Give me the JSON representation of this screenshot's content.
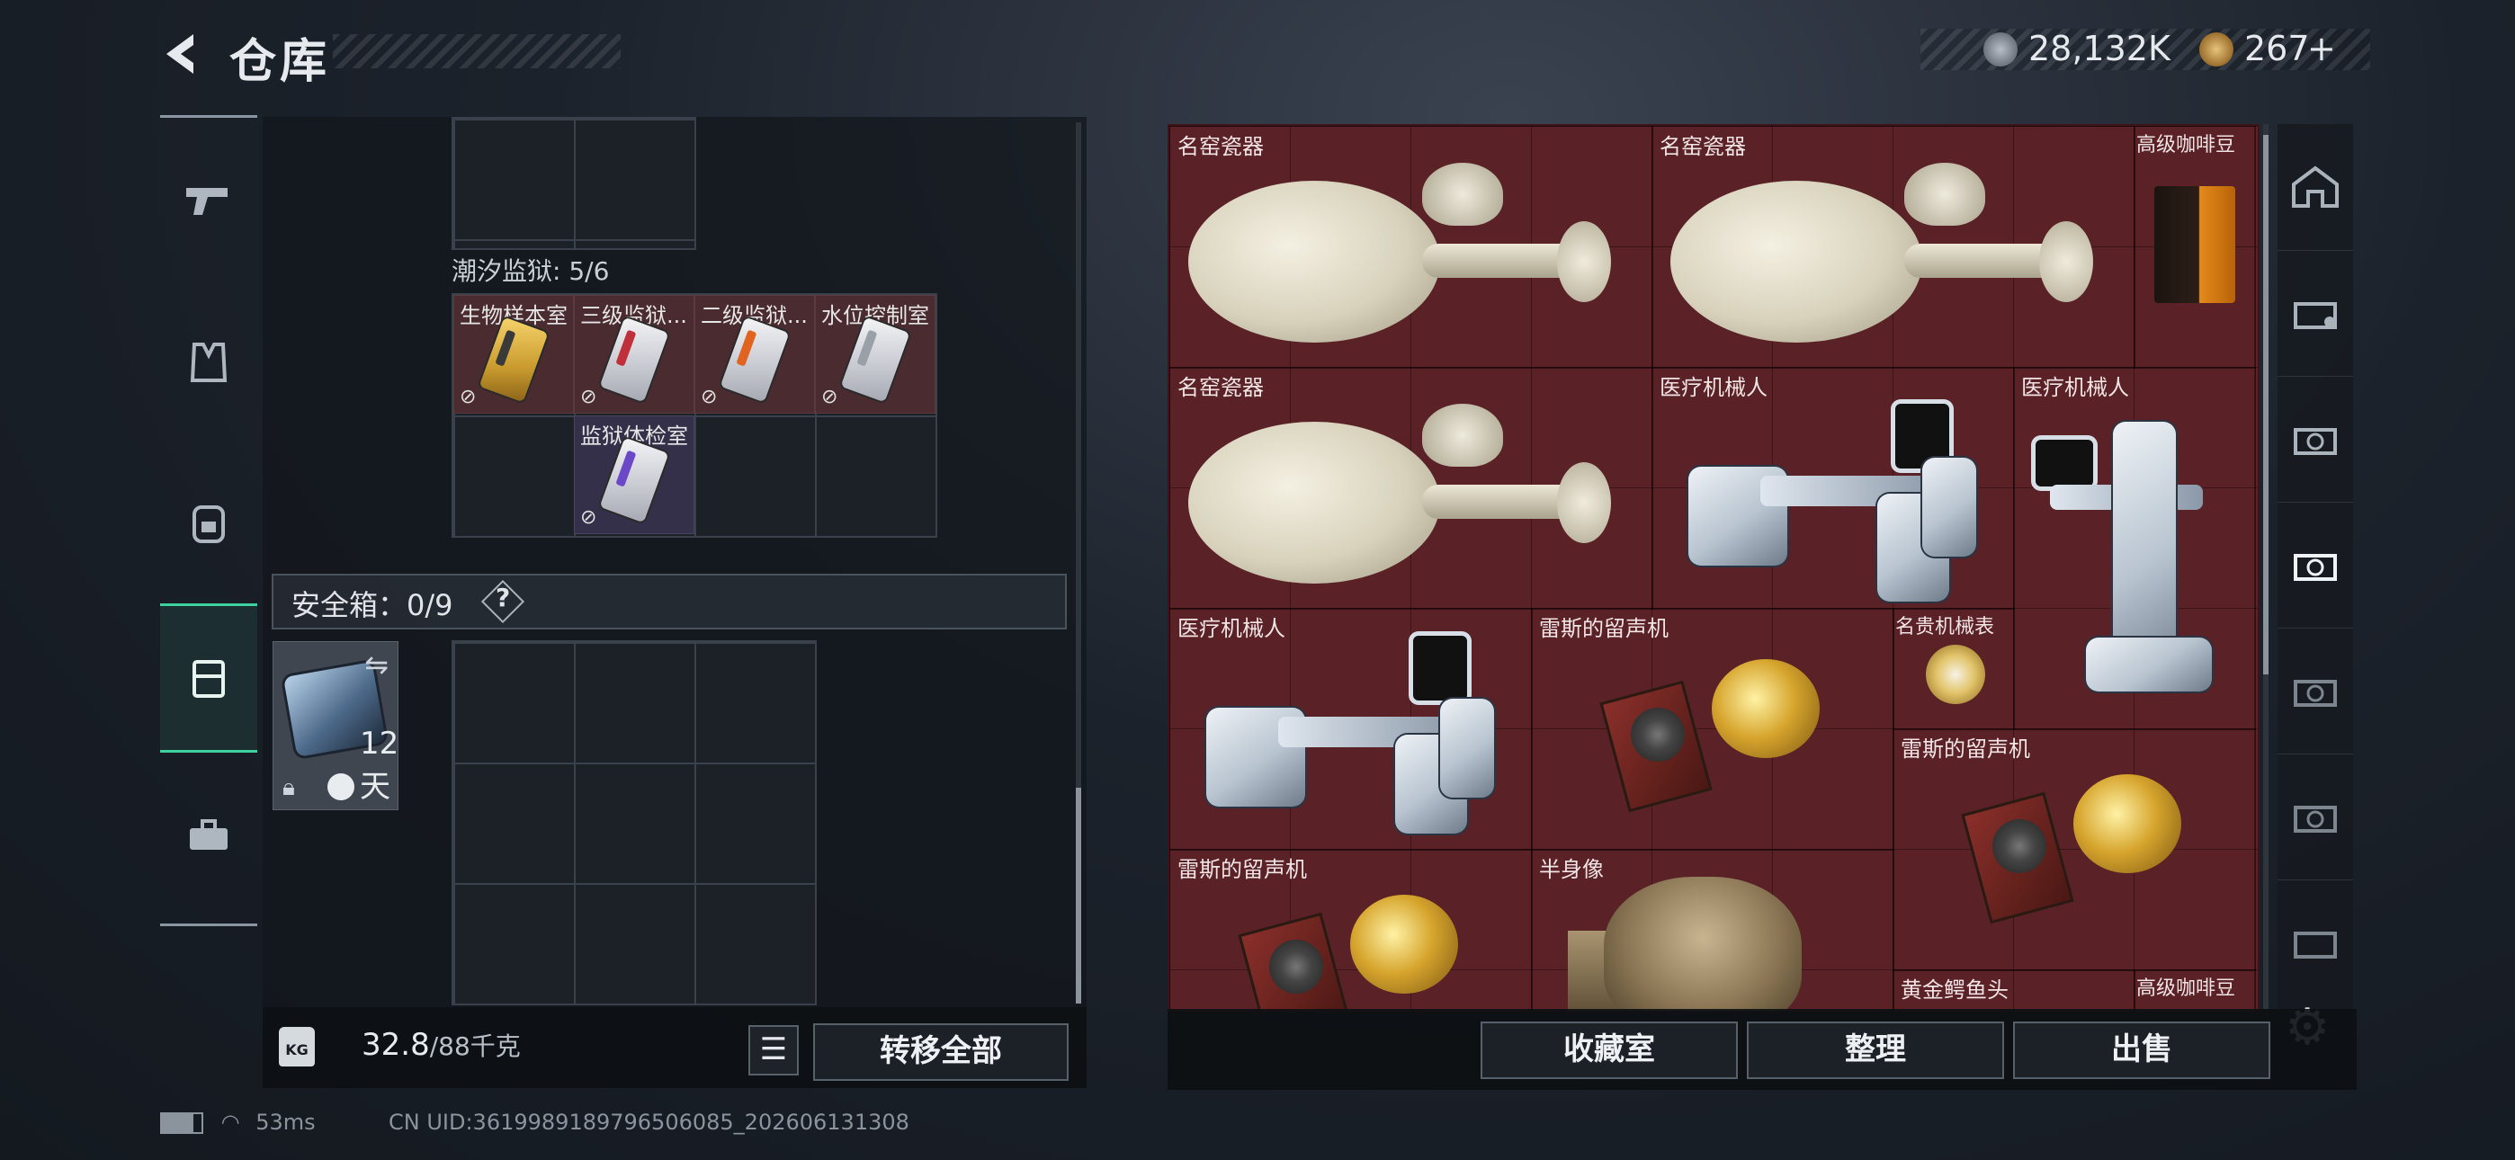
{
  "header": {
    "title": "仓库",
    "currency_primary": "28,132K",
    "currency_secondary": "267",
    "currency_secondary_plus": "+"
  },
  "left_nav": {
    "items": [
      {
        "icon": "pistol-icon"
      },
      {
        "icon": "vest-icon"
      },
      {
        "icon": "backpack-icon"
      },
      {
        "icon": "safe-case-icon",
        "active": true
      },
      {
        "icon": "toolbox-icon"
      }
    ]
  },
  "keycards": {
    "section_label": "潮汐监狱: 5/6",
    "cards": [
      {
        "label": "生物样本室",
        "color": "gold"
      },
      {
        "label": "三级监狱...",
        "color": "red"
      },
      {
        "label": "二级监狱...",
        "color": "orange"
      },
      {
        "label": "水位控制室",
        "color": "white"
      },
      {
        "label": "监狱体检室",
        "color": "purple"
      }
    ]
  },
  "safe": {
    "header": "安全箱：0/9",
    "help": "?",
    "days": "12天"
  },
  "left_bottom": {
    "kg_label": "KG",
    "weight_current": "32.8",
    "weight_max": "/88千克",
    "transfer_all": "转移全部"
  },
  "right_items": [
    {
      "label": "名窑瓷器"
    },
    {
      "label": "名窑瓷器"
    },
    {
      "label": "高级咖啡豆"
    },
    {
      "label": "名窑瓷器"
    },
    {
      "label": "医疗机械人"
    },
    {
      "label": "医疗机械人"
    },
    {
      "label": "医疗机械人"
    },
    {
      "label": "雷斯的留声机"
    },
    {
      "label": "名贵机械表"
    },
    {
      "label": "雷斯的留声机"
    },
    {
      "label": "雷斯的留声机"
    },
    {
      "label": "半身像"
    },
    {
      "label": "黄金鳄鱼头"
    },
    {
      "label": "高级咖啡豆"
    }
  ],
  "right_bottom": {
    "collection": "收藏室",
    "sort": "整理",
    "sell": "出售"
  },
  "status": {
    "ping": "53ms",
    "uid": "CN UID:3619989189796506085_202606131308"
  },
  "colors": {
    "accent": "#3ed1a0",
    "item_bg": "#5a2127"
  }
}
